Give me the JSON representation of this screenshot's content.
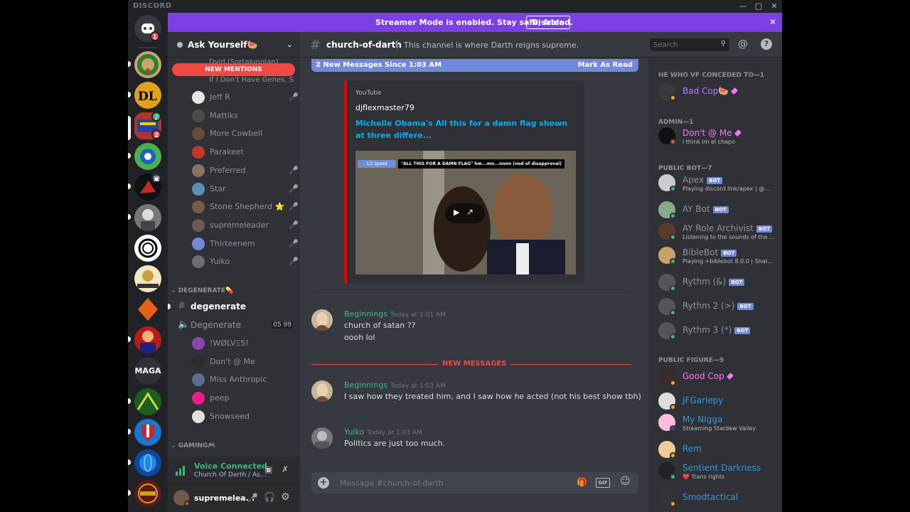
{
  "window": {
    "brand": "DISCORD"
  },
  "rail": {
    "dm_badge": "1",
    "badge2": "2"
  },
  "banner": {
    "text": "Streamer Mode is enabled. Stay safe, friend.",
    "disable": "Disable"
  },
  "guild": {
    "name": "Ask Yourself🍉"
  },
  "sidebar": {
    "new_mentions": "NEW MENTIONS",
    "cut1": "Dvid (SortaJungian)",
    "cut2": "If I Don't Have Genes, St...",
    "voice_users": [
      {
        "name": "Jeff R",
        "color": "#e6e6e6"
      },
      {
        "name": "Mattiks",
        "color": "#4b4b4b"
      },
      {
        "name": "More Cowbell",
        "color": "#6b4a3a"
      },
      {
        "name": "Parakeet",
        "color": "#c0392b"
      },
      {
        "name": "Preferred",
        "color": "#8a7360"
      },
      {
        "name": "Star",
        "color": "#5b8fb9"
      },
      {
        "name": "Stone Shepherd ⭐",
        "color": "#7a5a48"
      },
      {
        "name": "supremeleader",
        "color": "#6d5b4f"
      },
      {
        "name": "Thirteenem",
        "color": "#7289da"
      },
      {
        "name": "Yuiko",
        "color": "#6e6e6e"
      }
    ],
    "cat_degenerate": "DEGENERATE💊",
    "text_channel": "degenerate",
    "voice_channel": "Degenerate",
    "voice_counts": "05  99",
    "voice_users2": [
      {
        "name": "!WØLVΞS!",
        "color": "#8e44ad"
      },
      {
        "name": "Don't @ Me",
        "color": "#2c2c2c"
      },
      {
        "name": "Miss Anthropic",
        "color": "#5b6e8a"
      },
      {
        "name": "peep",
        "color": "#e91e8c"
      },
      {
        "name": "Snowseed",
        "color": "#e0e0e0"
      }
    ],
    "cat_gaming": "GAMING🎮"
  },
  "voice_connected": {
    "status": "Voice Connected",
    "location": "Church Of Darth / As..."
  },
  "user": {
    "name": "supremelea..."
  },
  "channel": {
    "name": "church-of-darth",
    "topic": "This channel is where Darth reigns supreme."
  },
  "search": {
    "placeholder": "Search"
  },
  "new_bar": {
    "left": "2 New Messages Since 1:03 AM",
    "right": "Mark As Read"
  },
  "embed": {
    "provider": "YouTube",
    "author": "djflexmaster79",
    "title": "Michelle Obama's  All this for a damn flag  shown at three differe...",
    "video_badge": "1/2 speed",
    "video_caption": "\"ALL THIS FOR A DAMN FLAG\" hm...mn...nnnn (nod of disapproval)"
  },
  "messages": [
    {
      "author": "Beginnings",
      "color": "#43b581",
      "time": "Today at 1:01 AM",
      "lines": [
        "church of satan ??",
        "oooh lol"
      ]
    },
    {
      "author": "Beginnings",
      "color": "#43b581",
      "time": "Today at 1:03 AM",
      "lines": [
        "I saw how they treated him, and I saw how he acted (not his best show tbh)"
      ]
    },
    {
      "author": "Yuiko",
      "color": "#43b581",
      "time": "Today at 1:03 AM",
      "lines": [
        "Politics are just too much."
      ]
    }
  ],
  "new_messages_divider": "NEW MESSAGES",
  "composer": {
    "placeholder": "Message #church-of-darth",
    "gif": "GIF"
  },
  "members": {
    "cat1": "HE WHO VF CONCEDED TO—1",
    "cat2": "ADMIN—1",
    "cat3": "PUBLIC BOT—7",
    "cat4": "PUBLIC FIGURE—9",
    "bot_tag": "BOT",
    "list": [
      {
        "name": "Bad Cop🍉",
        "color": "#b77cff"
      },
      {
        "name": "Don't @ Me",
        "color": "#ff73fa",
        "sub": "i think im el chapo"
      },
      {
        "name": "Apex",
        "color": "#8e9297",
        "sub": "Playing discord.link/apex | @..."
      },
      {
        "name": "AY Bot",
        "color": "#8e9297"
      },
      {
        "name": "AY Role Archivist",
        "color": "#8e9297",
        "sub": "Listening to the sounds of the ..."
      },
      {
        "name": "BibleBot",
        "color": "#8e9297",
        "sub": "Playing +biblebot 8.0.0 | Shar..."
      },
      {
        "name": "Rythm (&)",
        "color": "#8e9297"
      },
      {
        "name": "Rythm 2 (>)",
        "color": "#8e9297"
      },
      {
        "name": "Rythm 3 (*)",
        "color": "#8e9297"
      },
      {
        "name": "Good Cop",
        "color": "#ff73fa"
      },
      {
        "name": "JFGariepy",
        "color": "#3498db"
      },
      {
        "name": "My NIgga",
        "color": "#3498db",
        "sub": "Streaming Stardew Valley"
      },
      {
        "name": "Rem",
        "color": "#3498db"
      },
      {
        "name": "Sentient Darkness",
        "color": "#3498db",
        "sub": "❤️ Trans rights"
      },
      {
        "name": "Smodtactical",
        "color": "#3498db"
      }
    ]
  }
}
